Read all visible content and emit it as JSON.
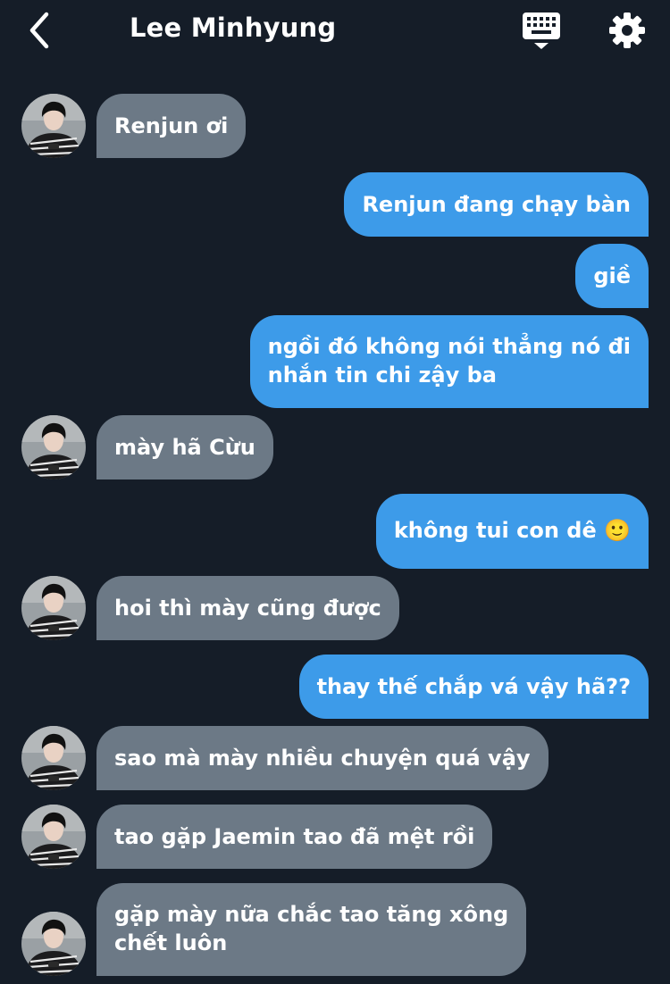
{
  "header": {
    "title": "Lee Minhyung",
    "back_icon": "chevron-left-icon",
    "keyboard_icon": "keyboard-icon",
    "settings_icon": "gear-icon"
  },
  "colors": {
    "background": "#151d28",
    "incoming_bubble": "#6c7986",
    "outgoing_bubble": "#3d9be9",
    "text": "#ffffff"
  },
  "messages": [
    {
      "sender": "Lee Minhyung",
      "direction": "incoming",
      "text": "Renjun ơi"
    },
    {
      "sender": "me",
      "direction": "outgoing",
      "text": "Renjun đang chạy bàn"
    },
    {
      "sender": "me",
      "direction": "outgoing",
      "text": "giề"
    },
    {
      "sender": "me",
      "direction": "outgoing",
      "lines": [
        "ngồi đó không nói thẳng nó đi",
        "nhắn tin chi zậy ba"
      ]
    },
    {
      "sender": "Lee Minhyung",
      "direction": "incoming",
      "text": "mày hã Cừu"
    },
    {
      "sender": "me",
      "direction": "outgoing",
      "text": "không tui con dê",
      "emoji": "🙂"
    },
    {
      "sender": "Lee Minhyung",
      "direction": "incoming",
      "text": "hoi thì mày cũng được"
    },
    {
      "sender": "me",
      "direction": "outgoing",
      "text": "thay thế chắp vá vậy hã??"
    },
    {
      "sender": "Lee Minhyung",
      "direction": "incoming",
      "text": "sao mà mày nhiều chuyện quá vậy"
    },
    {
      "sender": "Lee Minhyung",
      "direction": "incoming",
      "text": "tao gặp Jaemin tao đã mệt rồi"
    },
    {
      "sender": "Lee Minhyung",
      "direction": "incoming",
      "lines": [
        "gặp mày nữa chắc tao tăng xông",
        "chết luôn"
      ]
    }
  ]
}
